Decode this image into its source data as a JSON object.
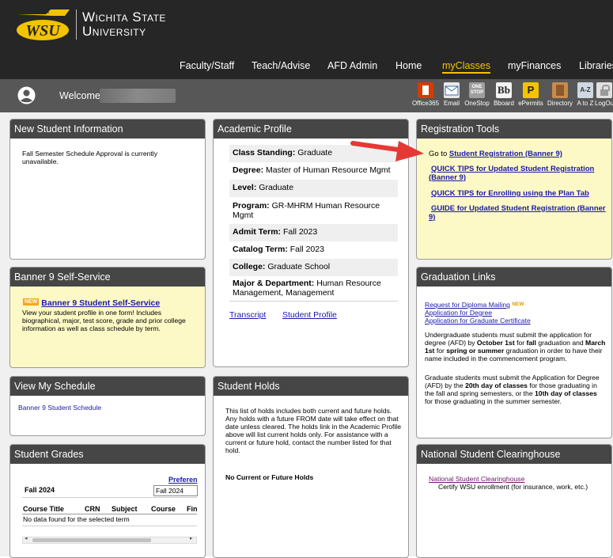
{
  "header": {
    "logo_mark": "WSU",
    "university_line1": "Wichita State",
    "university_line2": "University"
  },
  "nav": {
    "items": [
      "Faculty/Staff",
      "Teach/Advise",
      "AFD Admin",
      "Home",
      "myClasses",
      "myFinances",
      "Libraries"
    ],
    "active": "myClasses"
  },
  "welcome": {
    "label": "Welcome,"
  },
  "toolbar": {
    "items": [
      {
        "label": "Office365",
        "icon": "office365-icon",
        "color": "#d83b01"
      },
      {
        "label": "Email",
        "icon": "email-icon",
        "color": "#e8e8e8"
      },
      {
        "label": "OneStop",
        "icon": "onestop-icon",
        "color": "#9e9e9e"
      },
      {
        "label": "Bboard",
        "icon": "blackboard-icon",
        "color": "#2b2b2b"
      },
      {
        "label": "ePermits",
        "icon": "epermits-icon",
        "color": "#f2c400"
      },
      {
        "label": "Directory",
        "icon": "directory-icon",
        "color": "#c98a4b"
      },
      {
        "label": "A to Z",
        "icon": "atoz-icon",
        "color": "#cfd8e3"
      },
      {
        "label": "LogOut",
        "icon": "lock-icon",
        "color": "#e0e0e0"
      }
    ],
    "onestop_text": "ONE STOP",
    "bboard_text": "Bb",
    "epermits_text": "P",
    "atoz_text": "A-Z"
  },
  "new_student": {
    "title": "New Student Information",
    "message": "Fall Semester Schedule Approval is currently unavailable."
  },
  "academic_profile": {
    "title": "Academic Profile",
    "rows": [
      {
        "label": "Class Standing:",
        "value": "Graduate"
      },
      {
        "label": "Degree:",
        "value": "Master of Human Resource Mgmt"
      },
      {
        "label": "Level:",
        "value": "Graduate"
      },
      {
        "label": "Program:",
        "value": "GR-MHRM Human Resource Mgmt"
      },
      {
        "label": "Admit Term:",
        "value": "Fall 2023"
      },
      {
        "label": "Catalog Term:",
        "value": "Fall 2023"
      },
      {
        "label": "College:",
        "value": "Graduate School"
      },
      {
        "label": "Major & Department:",
        "value": "Human Resource Management, Management"
      }
    ],
    "transcript_link": "Transcript",
    "profile_link": "Student Profile"
  },
  "registration_tools": {
    "title": "Registration Tools",
    "go_to_prefix": "Go to",
    "go_to_link": "Student Registration (Banner 9)",
    "links": [
      "QUICK TIPS for Updated Student Registration (Banner 9)",
      "QUICK TIPS for Enrolling using the Plan Tab",
      "GUIDE for Updated Student Registration (Banner 9)"
    ]
  },
  "banner9": {
    "title": "Banner 9 Self-Service",
    "new_badge": "NEW",
    "link": "Banner 9 Student Self-Service",
    "description": "View your student profile in one form! Includes biographical, major, test score, grade and prior college information as well as class schedule by term."
  },
  "graduation": {
    "title": "Graduation Links",
    "links": [
      "Request for Diploma Mailing",
      "Application for Degree",
      "Application for Graduate Certificate"
    ],
    "new_tag": "NEW",
    "ug_p1": "Undergraduate students must submit the application for degree (AFD) by",
    "ug_b1": "October 1st",
    "ug_p2": "for",
    "ug_b2": "fall",
    "ug_p3": "graduation and",
    "ug_b3": "March 1st",
    "ug_p4": "for",
    "ug_b4": "spring or summer",
    "ug_p5": "graduation in order to have their name included in the commencement program.",
    "gr_p1": "Graduate students must submit the Application for Degree (AFD) by the",
    "gr_b1": "20th day of classes",
    "gr_p2": "for those graduating in the fall and spring semesters, or the",
    "gr_b2": "10th day of classes",
    "gr_p3": "for those graduating in the summer semester."
  },
  "schedule": {
    "title": "View My Schedule",
    "link": "Banner 9 Student Schedule"
  },
  "holds": {
    "title": "Student Holds",
    "description": "This list of holds includes both current and future holds. Any holds with a future FROM date will take effect on that date unless cleared. The holds link in the Academic Profile above will list current holds only. For assistance with a current or future hold, contact the number listed for that hold.",
    "none": "No Current or Future Holds"
  },
  "grades": {
    "title": "Student Grades",
    "preferences_link": "Preferen",
    "term_label": "Fall 2024",
    "term_select": "Fall 2024",
    "columns": [
      "Course Title",
      "CRN",
      "Subject",
      "Course",
      "Fin"
    ],
    "empty": "No data found for the selected term"
  },
  "clearinghouse": {
    "title": "National Student Clearinghouse",
    "link": "National Student Clearinghouse",
    "description": "Certify WSU enrollment (for insurance, work, etc.)"
  },
  "colors": {
    "header_bg": "#262626",
    "welcome_bg": "#575757",
    "panel_head": "#464646",
    "gold": "#f2c400",
    "highlight_yellow": "#fdf9c6",
    "arrow_red": "#e53935"
  }
}
